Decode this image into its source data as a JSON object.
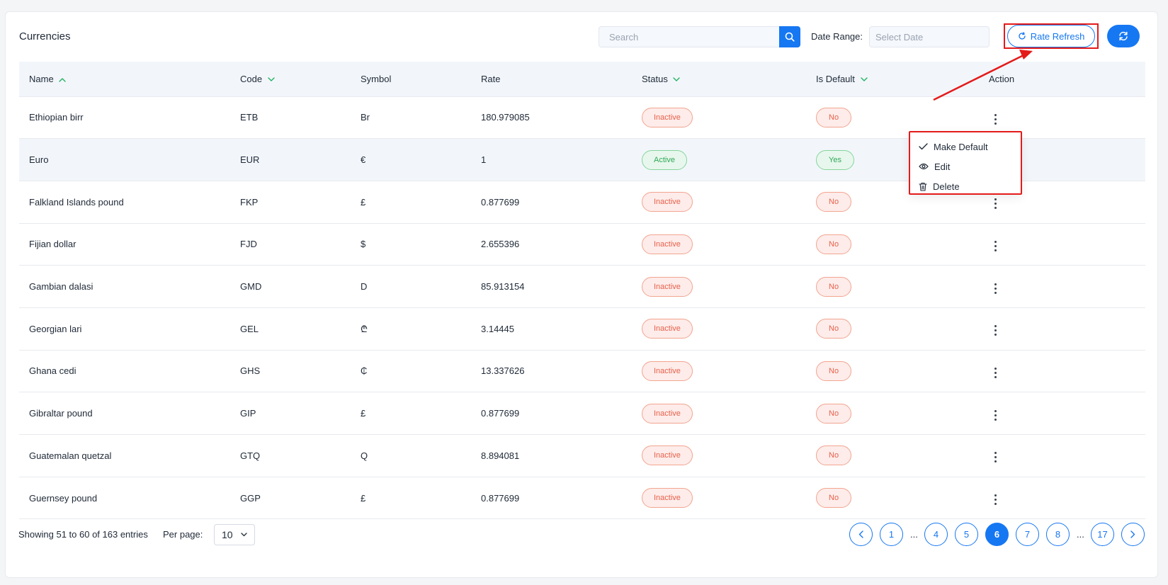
{
  "header": {
    "title": "Currencies",
    "search_placeholder": "Search",
    "date_range_label": "Date Range:",
    "date_placeholder": "Select Date",
    "rate_refresh_label": "Rate Refresh"
  },
  "table": {
    "columns": [
      "Name",
      "Code",
      "Symbol",
      "Rate",
      "Status",
      "Is Default",
      "Action"
    ],
    "rows": [
      {
        "name": "Ethiopian birr",
        "code": "ETB",
        "symbol": "Br",
        "rate": "180.979085",
        "status": "Inactive",
        "is_default": "No"
      },
      {
        "name": "Euro",
        "code": "EUR",
        "symbol": "€",
        "rate": "1",
        "status": "Active",
        "is_default": "Yes"
      },
      {
        "name": "Falkland Islands pound",
        "code": "FKP",
        "symbol": "£",
        "rate": "0.877699",
        "status": "Inactive",
        "is_default": "No"
      },
      {
        "name": "Fijian dollar",
        "code": "FJD",
        "symbol": "$",
        "rate": "2.655396",
        "status": "Inactive",
        "is_default": "No"
      },
      {
        "name": "Gambian dalasi",
        "code": "GMD",
        "symbol": "D",
        "rate": "85.913154",
        "status": "Inactive",
        "is_default": "No"
      },
      {
        "name": "Georgian lari",
        "code": "GEL",
        "symbol": "₾",
        "rate": "3.14445",
        "status": "Inactive",
        "is_default": "No"
      },
      {
        "name": "Ghana cedi",
        "code": "GHS",
        "symbol": "₵",
        "rate": "13.337626",
        "status": "Inactive",
        "is_default": "No"
      },
      {
        "name": "Gibraltar pound",
        "code": "GIP",
        "symbol": "£",
        "rate": "0.877699",
        "status": "Inactive",
        "is_default": "No"
      },
      {
        "name": "Guatemalan quetzal",
        "code": "GTQ",
        "symbol": "Q",
        "rate": "8.894081",
        "status": "Inactive",
        "is_default": "No"
      },
      {
        "name": "Guernsey pound",
        "code": "GGP",
        "symbol": "£",
        "rate": "0.877699",
        "status": "Inactive",
        "is_default": "No"
      }
    ]
  },
  "dropdown": {
    "items": [
      "Make Default",
      "Edit",
      "Delete"
    ]
  },
  "footer": {
    "showing": "Showing 51 to 60 of 163 entries",
    "per_page_label": "Per page:",
    "per_page_value": "10",
    "pages": [
      "1",
      "...",
      "4",
      "5",
      "6",
      "7",
      "8",
      "...",
      "17"
    ],
    "current_page": "6"
  },
  "colors": {
    "primary": "#1677f2",
    "annotation": "#e41b1b",
    "inactive": "#e8614a",
    "active": "#2fa857"
  }
}
